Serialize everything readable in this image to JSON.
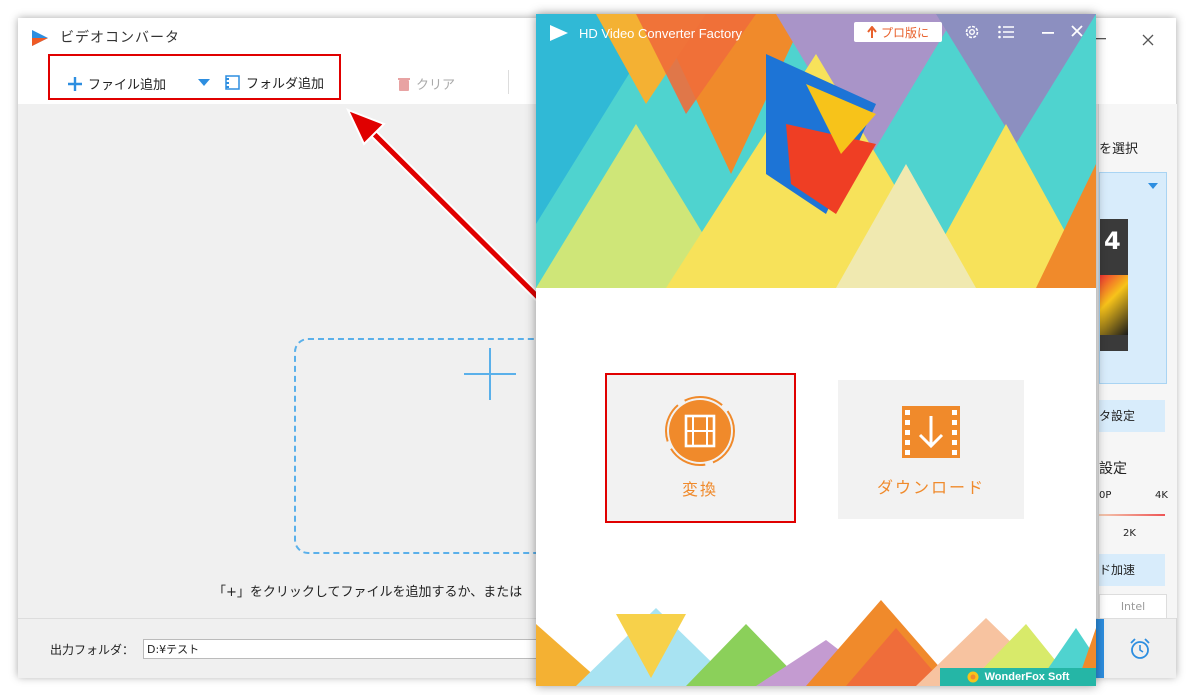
{
  "background_window": {
    "title": "ビデオコンバータ",
    "toolbar": {
      "add_file_label": "ファイル追加",
      "add_folder_label": "フォルダ追加",
      "clear_label": "クリア"
    },
    "drop_hint": "「+」をクリックしてファイルを追加するか、または",
    "right_panel": {
      "format_select_label": "を選択",
      "param_settings_label": "タ設定",
      "quality_label": "設定",
      "quality_ticks": [
        "0P",
        "4K",
        "2K"
      ],
      "hw_accel_label": "ド加速",
      "intel_label": "Intel"
    },
    "output": {
      "label": "出力フォルダ：",
      "value": "D:¥テスト"
    }
  },
  "launcher_window": {
    "title": "HD Video Converter Factory",
    "pro_button_label": "プロ版に",
    "tiles": [
      {
        "label": "変換"
      },
      {
        "label": "ダウンロード"
      }
    ],
    "brand": "WonderFox Soft"
  },
  "colors": {
    "accent_orange": "#f08a2b",
    "highlight_red": "#e00000",
    "link_blue": "#2d8ee0",
    "teal": "#3ec9c4"
  }
}
